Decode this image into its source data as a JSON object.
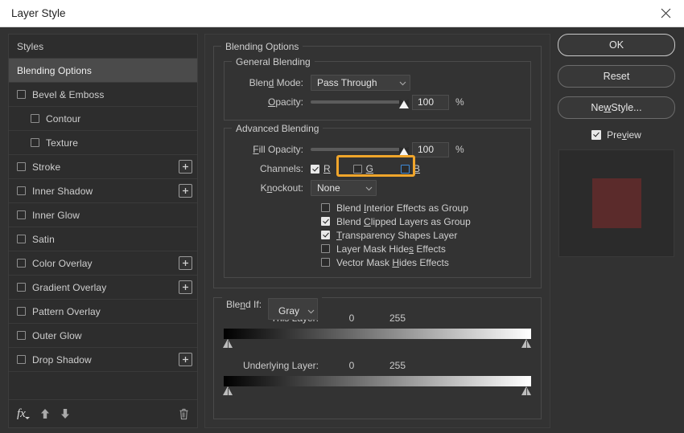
{
  "window": {
    "title": "Layer Style",
    "close_icon": "close-icon"
  },
  "sidebar": {
    "header_label": "Styles",
    "selected_label": "Blending Options",
    "items": [
      {
        "label": "Bevel & Emboss",
        "checked": false,
        "indent": false,
        "plus": false
      },
      {
        "label": "Contour",
        "checked": false,
        "indent": true,
        "plus": false
      },
      {
        "label": "Texture",
        "checked": false,
        "indent": true,
        "plus": false
      },
      {
        "label": "Stroke",
        "checked": false,
        "indent": false,
        "plus": true
      },
      {
        "label": "Inner Shadow",
        "checked": false,
        "indent": false,
        "plus": true
      },
      {
        "label": "Inner Glow",
        "checked": false,
        "indent": false,
        "plus": false
      },
      {
        "label": "Satin",
        "checked": false,
        "indent": false,
        "plus": false
      },
      {
        "label": "Color Overlay",
        "checked": false,
        "indent": false,
        "plus": true
      },
      {
        "label": "Gradient Overlay",
        "checked": false,
        "indent": false,
        "plus": true
      },
      {
        "label": "Pattern Overlay",
        "checked": false,
        "indent": false,
        "plus": false
      },
      {
        "label": "Outer Glow",
        "checked": false,
        "indent": false,
        "plus": false
      },
      {
        "label": "Drop Shadow",
        "checked": false,
        "indent": false,
        "plus": true
      }
    ],
    "toolbar": {
      "fx_label": "fx",
      "fx_icon": "fx-menu-icon",
      "up_icon": "move-up-icon",
      "down_icon": "move-down-icon",
      "delete_icon": "trash-icon"
    }
  },
  "main": {
    "group_title": "Blending Options",
    "general": {
      "legend": "General Blending",
      "blend_mode_label": "Blend Mode:",
      "blend_mode_value": "Pass Through",
      "opacity_label": "Opacity:",
      "opacity_value": "100",
      "percent": "%"
    },
    "advanced": {
      "legend": "Advanced Blending",
      "fill_opacity_label": "Fill Opacity:",
      "fill_opacity_value": "100",
      "percent": "%",
      "channels_label": "Channels:",
      "channels": [
        {
          "label": "R",
          "checked": true,
          "focused": false
        },
        {
          "label": "G",
          "checked": false,
          "focused": false
        },
        {
          "label": "B",
          "checked": false,
          "focused": true
        }
      ],
      "highlight_color": "#f0a52b",
      "knockout_label": "Knockout:",
      "knockout_value": "None",
      "options": [
        {
          "label": "Blend Interior Effects as Group",
          "checked": false
        },
        {
          "label": "Blend Clipped Layers as Group",
          "checked": true
        },
        {
          "label": "Transparency Shapes Layer",
          "checked": true
        },
        {
          "label": "Layer Mask Hides Effects",
          "checked": false
        },
        {
          "label": "Vector Mask Hides Effects",
          "checked": false
        }
      ]
    },
    "blend_if": {
      "label": "Blend If:",
      "channel_value": "Gray",
      "this_layer": {
        "name": "This Layer:",
        "low": "0",
        "high": "255"
      },
      "underlying_layer": {
        "name": "Underlying Layer:",
        "low": "0",
        "high": "255"
      }
    }
  },
  "right": {
    "ok_label": "OK",
    "reset_label": "Reset",
    "new_style_label": "New Style...",
    "preview_label": "Preview",
    "preview_checked": true,
    "swatch_color": "#5b2b2b",
    "thumb_bg": "#2b2b2b"
  }
}
